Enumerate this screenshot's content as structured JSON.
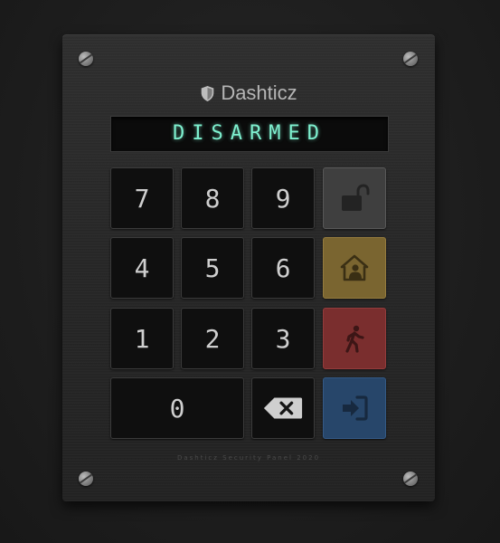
{
  "brand": {
    "name": "Dashticz",
    "icon": "shield-icon"
  },
  "display": {
    "status": "DISARMED",
    "color": "#7ef0cf"
  },
  "keypad": {
    "keys": [
      "7",
      "8",
      "9",
      "4",
      "5",
      "6",
      "1",
      "2",
      "3",
      "0"
    ],
    "backspace_icon": "backspace-icon"
  },
  "function_keys": [
    {
      "name": "disarm",
      "icon": "unlock-icon",
      "color": "#3f3f3f"
    },
    {
      "name": "arm-home",
      "icon": "home-person-icon",
      "color": "#7a6530"
    },
    {
      "name": "arm-away",
      "icon": "walking-person-icon",
      "color": "#7a2e2e"
    },
    {
      "name": "enter",
      "icon": "sign-in-icon",
      "color": "#27466a"
    }
  ],
  "footer": {
    "text": "Dashticz Security Panel 2020"
  }
}
